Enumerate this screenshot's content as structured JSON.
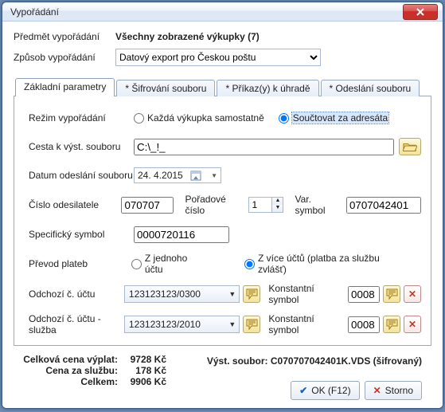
{
  "window": {
    "title": "Vypořádání"
  },
  "header": {
    "subject_label": "Předmět vypořádání",
    "subject_value": "Všechny zobrazené výkupky (7)",
    "method_label": "Způsob vypořádání",
    "method_selected": "Datový export pro Českou poštu"
  },
  "tabs": {
    "t0": "Základní parametry",
    "t1": "* Šifrování souboru",
    "t2": "* Příkaz(y) k úhradě",
    "t3": "* Odeslání souboru"
  },
  "form": {
    "mode_label": "Režim vypořádání",
    "mode_opt_each": "Každá výkupka samostatně",
    "mode_opt_sum": "Součtovat za adresáta",
    "path_label": "Cesta k výst. souboru",
    "path_value": "C:\\_!_",
    "date_label": "Datum odeslání souboru",
    "date_value": "24.  4.2015",
    "sender_label": "Číslo odesilatele",
    "sender_value": "070707",
    "seq_label": "Pořadové číslo",
    "seq_value": "1",
    "vs_label": "Var. symbol",
    "vs_value": "0707042401",
    "ss_label": "Specifický symbol",
    "ss_value": "0000720116",
    "transfer_label": "Převod plateb",
    "transfer_opt_one": "Z jednoho účtu",
    "transfer_opt_multi": "Z více účtů (platba za službu zvlášť)",
    "acct_out_label": "Odchozí č. účtu",
    "acct_out_value": "123123123/0300",
    "ks_label": "Konstantní symbol",
    "ks_value_1": "0008",
    "acct_svc_label": "Odchozí č. účtu - služba",
    "acct_svc_value": "123123123/2010",
    "ks_value_2": "0008"
  },
  "totals": {
    "payout_label": "Celková cena výplat:",
    "payout_value": "9728 Kč",
    "service_label": "Cena za službu:",
    "service_value": "178 Kč",
    "total_label": "Celkem:",
    "total_value": "9906 Kč"
  },
  "output": {
    "label": "Výst. soubor: ",
    "value": "C070707042401K.VDS (šifrovaný)"
  },
  "buttons": {
    "ok": "OK (F12)",
    "storno": "Storno"
  }
}
